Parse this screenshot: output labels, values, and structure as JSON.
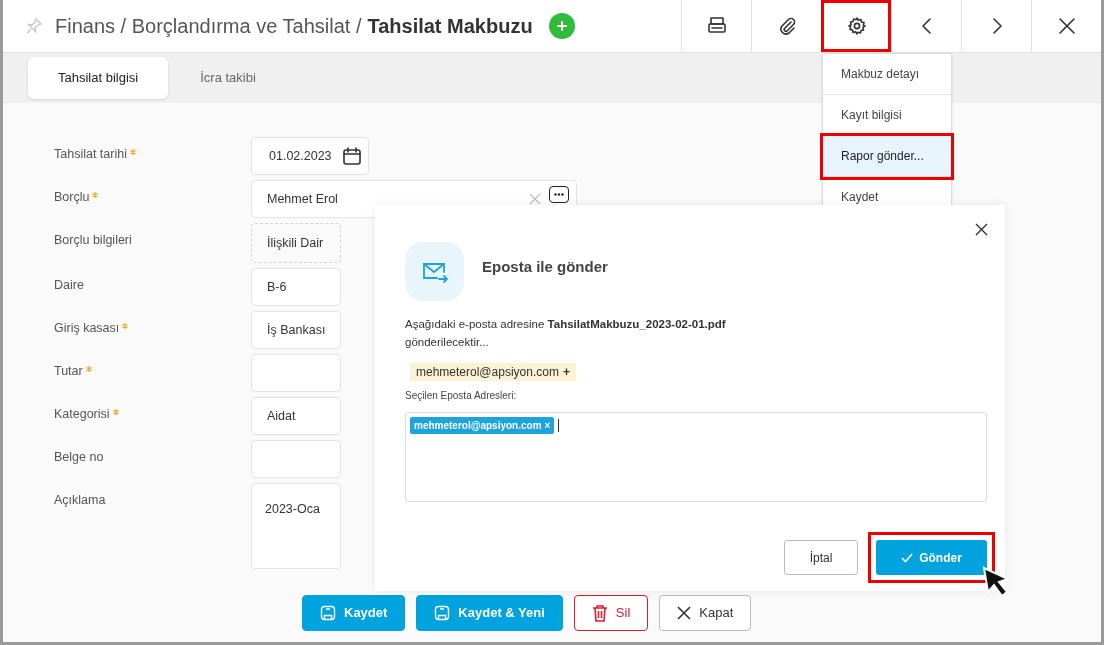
{
  "header": {
    "path": "Finans / Borçlandırma ve Tahsilat /",
    "title": "Tahsilat Makbuzu"
  },
  "toolbar": [
    {
      "kind": "print",
      "highlighted": false
    },
    {
      "kind": "attach",
      "highlighted": false
    },
    {
      "kind": "settings",
      "highlighted": true
    },
    {
      "kind": "prev",
      "highlighted": false
    },
    {
      "kind": "next",
      "highlighted": false
    },
    {
      "kind": "close",
      "highlighted": false
    }
  ],
  "tabs": [
    {
      "label": "Tahsilat bilgisi",
      "selected": true
    },
    {
      "label": "İcra takibi",
      "selected": false
    }
  ],
  "fields": [
    {
      "label": "Tahsilat tarihi",
      "required": true,
      "kind": "date",
      "value": "01.02.2023"
    },
    {
      "label": "Borçlu",
      "required": true,
      "kind": "lookup",
      "value": "Mehmet Erol"
    },
    {
      "label": "Borçlu bilgileri",
      "required": false,
      "kind": "info",
      "value": "İlişkili Dair"
    },
    {
      "label": "Daire",
      "required": false,
      "kind": "text",
      "value": "B-6"
    },
    {
      "label": "Giriş kasası",
      "required": true,
      "kind": "text",
      "value": "İş Bankası"
    },
    {
      "label": "Tutar",
      "required": true,
      "kind": "text"
    },
    {
      "label": "Kategorisi",
      "required": true,
      "kind": "text",
      "value": "Aidat"
    },
    {
      "label": "Belge no",
      "required": false,
      "kind": "text"
    },
    {
      "label": "Açıklama",
      "required": false,
      "kind": "textarea",
      "value": "2023-Oca"
    }
  ],
  "menu": [
    {
      "label": "Makbuz detayı",
      "selected": false,
      "highlighted": false
    },
    {
      "label": "Kayıt bilgisi",
      "selected": false,
      "highlighted": false
    },
    {
      "label": "Rapor gönder...",
      "selected": true,
      "highlighted": true
    },
    {
      "label": "Kaydet",
      "selected": false,
      "highlighted": false
    }
  ],
  "dialog": {
    "title": "Eposta ile gönder",
    "message": "Aşağıdaki e-posta adresine **TahsilatMakbuzu_2023-02-01.pdf** gönderilecektir...",
    "suggestion": {
      "address": "mehmeterol@apsiyon.com",
      "action": "+"
    },
    "selected_label": "Seçilen Eposta Adresleri:",
    "selected_addresses": [
      {
        "address": "mehmeterol@apsiyon.com",
        "remove": "×"
      }
    ],
    "buttons": [
      {
        "label": "İptal",
        "kind": "secondary",
        "highlighted": false
      },
      {
        "label": "Gönder",
        "kind": "primary",
        "highlighted": true
      }
    ]
  },
  "buttons": [
    {
      "label": "Kaydet",
      "kind": "save"
    },
    {
      "label": "Kaydet & Yeni",
      "kind": "save"
    },
    {
      "label": "Sil",
      "kind": "delete"
    },
    {
      "label": "Kapat",
      "kind": "close"
    }
  ]
}
